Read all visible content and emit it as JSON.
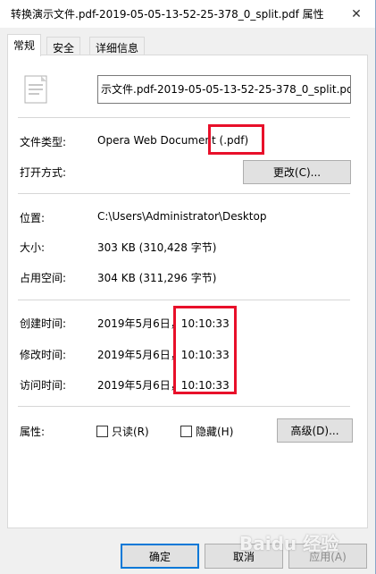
{
  "window": {
    "title": "转换演示文件.pdf-2019-05-05-13-52-25-378_0_split.pdf 属性",
    "close_glyph": "✕"
  },
  "tabs": [
    {
      "label": "常规",
      "active": true
    },
    {
      "label": "安全",
      "active": false
    },
    {
      "label": "详细信息",
      "active": false
    }
  ],
  "general": {
    "file_name": "示文件.pdf-2019-05-05-13-52-25-378_0_split.pdf",
    "file_type_label": "文件类型:",
    "file_type_value": "Opera Web Document (.pdf)",
    "opens_with_label": "打开方式:",
    "change_button": "更改(C)...",
    "location_label": "位置:",
    "location_value": "C:\\Users\\Administrator\\Desktop",
    "size_label": "大小:",
    "size_value": "303 KB (310,428 字节)",
    "size_on_disk_label": "占用空间:",
    "size_on_disk_value": "304 KB (311,296 字节)",
    "created_label": "创建时间:",
    "created_value": "2019年5月6日，10:10:33",
    "modified_label": "修改时间:",
    "modified_value": "2019年5月6日，10:10:33",
    "accessed_label": "访问时间:",
    "accessed_value": "2019年5月6日，10:10:33",
    "attributes_label": "属性:",
    "readonly_label": "只读(R)",
    "readonly_checked": false,
    "hidden_label": "隐藏(H)",
    "hidden_checked": false,
    "advanced_button": "高级(D)..."
  },
  "footer": {
    "ok_button": "确定",
    "cancel_button": "取消",
    "apply_button": "应用(A)"
  },
  "watermark": "Baidu 经验",
  "colors": {
    "highlight": "#e8102a",
    "accent": "#0078d7"
  }
}
